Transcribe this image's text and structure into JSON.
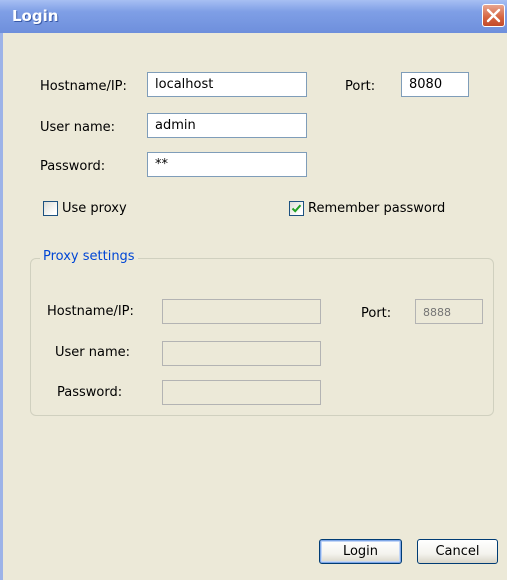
{
  "window": {
    "title": "Login"
  },
  "login": {
    "hostname_label": "Hostname/IP:",
    "hostname_value": "localhost",
    "port_label": "Port:",
    "port_value": "8080",
    "username_label": "User name:",
    "username_value": "admin",
    "password_label": "Password:",
    "password_value": "**"
  },
  "options": {
    "use_proxy_label": "Use proxy",
    "use_proxy_checked": false,
    "remember_password_label": "Remember password",
    "remember_password_checked": true
  },
  "proxy": {
    "group_title": "Proxy settings",
    "hostname_label": "Hostname/IP:",
    "hostname_value": "",
    "port_label": "Port:",
    "port_placeholder": "8888",
    "username_label": "User name:",
    "username_value": "",
    "password_label": "Password:",
    "password_value": ""
  },
  "buttons": {
    "login": "Login",
    "cancel": "Cancel"
  },
  "colors": {
    "title_bar": "#7f9fe6",
    "client_bg": "#ece9d8",
    "group_title": "#0046d5",
    "check_mark": "#21a121",
    "close_button": "#d5633f"
  },
  "icons": {
    "close": "close-x-icon",
    "check": "checkmark-icon"
  }
}
